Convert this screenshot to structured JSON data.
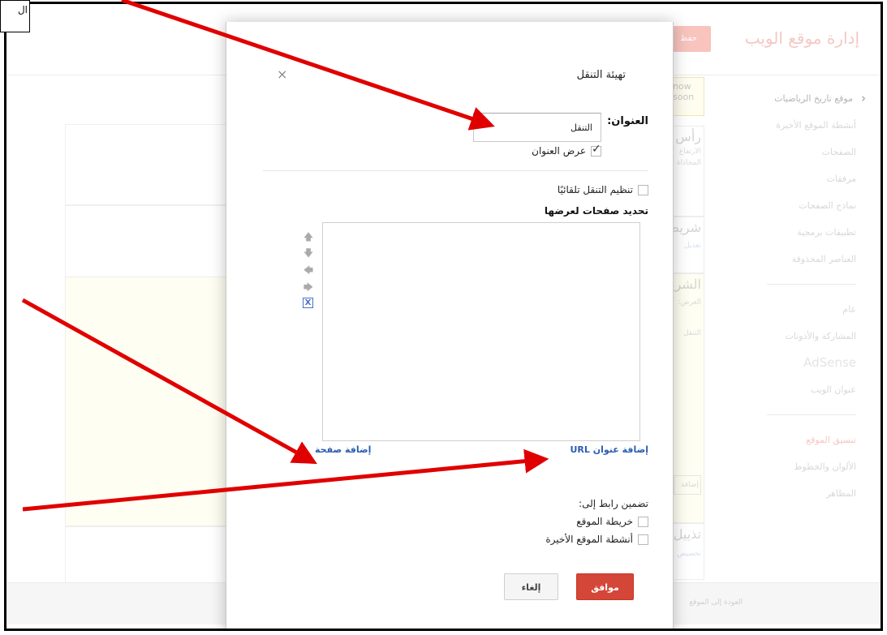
{
  "background": {
    "app_title": "إدارة موقع الويب",
    "save_label": "حفظ",
    "site_link": "موقع تاريخ الرياضيات",
    "nav_group1": [
      "أنشطة الموقع الأخيرة",
      "الصفحات",
      "مرفقات",
      "نماذج الصفحات",
      "تطبيقات برمجية",
      "العناصر المحذوفة"
    ],
    "nav_group2": [
      "عام",
      "المشاركة والأذونات",
      "AdSense",
      "عنوان الويب"
    ],
    "nav_group3": [
      "تنسيق الموقع",
      "الألوان والخطوط",
      "المظاهر"
    ],
    "footer_link": "العودة إلى الموقع",
    "notice_line1": "now",
    "notice_line2": "soon",
    "gadget_header_title": "رأس",
    "gadget_header_line1": "الارتفاع",
    "gadget_header_line2": "المحاذاة",
    "gadget_nav_title": "شريط",
    "gadget_nav_link": "تعديل",
    "gadget_sidebar_title": "الشريط",
    "gadget_sidebar_line": "العرض:",
    "gadget_sidebar_item": "التنقل",
    "gadget_sidebar_add": "إضافة",
    "gadget_footer_title": "تذييل",
    "gadget_footer_link": "تخصيص"
  },
  "dialog": {
    "title": "تهيئة التنقل",
    "close_symbol": "×",
    "title_field_label": "العنوان:",
    "title_field_value": "التنقل",
    "show_title_label": "عرض العنوان",
    "show_title_checked": true,
    "auto_organize_label": "تنظيم التنقل تلقائيًا",
    "auto_organize_checked": false,
    "pages_heading": "تحديد صفحات لعرضها",
    "controls": {
      "move_up": "🡅",
      "move_down": "🡇",
      "move_left": "🡄",
      "move_right": "🡆",
      "remove": "X"
    },
    "add_url_label": "إضافة عنوان URL",
    "add_page_label": "إضافة صفحة",
    "include_link_heading": "تضمين رابط إلى:",
    "include_options": [
      {
        "label": "خريطة الموقع",
        "checked": false
      },
      {
        "label": "أنشطة الموقع الأخيرة",
        "checked": false
      }
    ],
    "ok_label": "موافق",
    "cancel_label": "إلغاء"
  },
  "annotation": {
    "box_text": "ال"
  },
  "colors": {
    "primary_button": "#d44638",
    "link": "#2a5db0",
    "arrow": "#e00000"
  }
}
